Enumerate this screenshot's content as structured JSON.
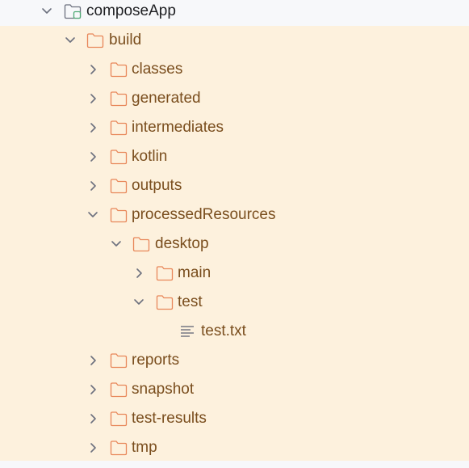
{
  "project_tree": {
    "root": {
      "label": "composeApp"
    },
    "build": {
      "label": "build"
    },
    "build_children": {
      "classes": {
        "label": "classes"
      },
      "generated": {
        "label": "generated"
      },
      "intermediates": {
        "label": "intermediates"
      },
      "kotlin": {
        "label": "kotlin"
      },
      "outputs": {
        "label": "outputs"
      },
      "processedResources": {
        "label": "processedResources"
      },
      "desktop": {
        "label": "desktop"
      },
      "main": {
        "label": "main"
      },
      "test": {
        "label": "test"
      },
      "test_txt": {
        "label": "test.txt"
      },
      "reports": {
        "label": "reports"
      },
      "snapshot": {
        "label": "snapshot"
      },
      "test_results": {
        "label": "test-results"
      },
      "tmp": {
        "label": "tmp"
      }
    }
  },
  "colors": {
    "excluded_background": "#fdf1dd",
    "excluded_text": "#7a4e1e",
    "folder_stroke": "#e8875a",
    "module_folder_stroke": "#6c707e",
    "module_badge": "#4faa75",
    "chevron": "#6c707e"
  }
}
